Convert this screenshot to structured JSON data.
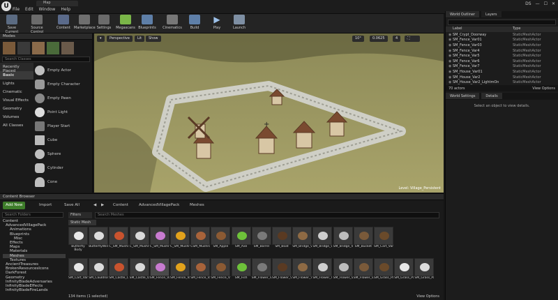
{
  "window": {
    "tab_title": "Map",
    "menu": [
      "File",
      "Edit",
      "Window",
      "Help"
    ],
    "right_label": "DS"
  },
  "toolbar": {
    "buttons": [
      {
        "label": "Save Current",
        "color": "#5b6b82"
      },
      {
        "label": "Source Control",
        "color": "#6b6b6b"
      },
      {
        "label": "Content",
        "color": "#5a6a8a"
      },
      {
        "label": "Marketplace",
        "color": "#6f6f6f"
      },
      {
        "label": "Settings",
        "color": "#6b6b6b"
      },
      {
        "label": "Megascans",
        "color": "#7ab648"
      },
      {
        "label": "Blueprints",
        "color": "#5e7fa8"
      },
      {
        "label": "Cinematics",
        "color": "#777777"
      },
      {
        "label": "Build",
        "color": "#5e7fa8"
      },
      {
        "label": "Play",
        "color": "#6a8fb8"
      },
      {
        "label": "Launch",
        "color": "#7e8fa3"
      }
    ]
  },
  "modes": {
    "title": "Modes",
    "search_placeholder": "Search Classes",
    "categories": [
      "Recently Placed",
      "Basic",
      "Lights",
      "Cinematic",
      "Visual Effects",
      "Geometry",
      "Volumes",
      "All Classes"
    ],
    "selected_category": "Basic",
    "actors": [
      "Empty Actor",
      "Empty Character",
      "Empty Pawn",
      "Point Light",
      "Player Start",
      "Cube",
      "Sphere",
      "Cylinder",
      "Cone"
    ]
  },
  "viewport": {
    "view": "Perspective",
    "lit": "Lit",
    "show": "Show",
    "snap1": "10°",
    "snap2": "0.0625",
    "snap3": "4",
    "level": "Level: Village_Persistent"
  },
  "outliner": {
    "tabs": [
      "World Outliner",
      "Layers"
    ],
    "col_label": "Label",
    "col_type": "Type",
    "rows": [
      {
        "label": "SM_Crypt_Doorway",
        "type": "StaticMeshActor"
      },
      {
        "label": "SM_Fence_Var01",
        "type": "StaticMeshActor"
      },
      {
        "label": "SM_Fence_Var03",
        "type": "StaticMeshActor"
      },
      {
        "label": "SM_Fence_Var4",
        "type": "StaticMeshActor"
      },
      {
        "label": "SM_Fence_Var5",
        "type": "StaticMeshActor"
      },
      {
        "label": "SM_Fence_Var6",
        "type": "StaticMeshActor"
      },
      {
        "label": "SM_Fence_Var7",
        "type": "StaticMeshActor"
      },
      {
        "label": "SM_House_Var01",
        "type": "StaticMeshActor"
      },
      {
        "label": "SM_House_Var2",
        "type": "StaticMeshActor"
      },
      {
        "label": "SM_House_Var2_LightmOn",
        "type": "StaticMeshActor"
      }
    ],
    "count": "70 actors",
    "view_options": "View Options"
  },
  "details": {
    "tabs": [
      "World Settings",
      "Details"
    ],
    "message": "Select an object to view details."
  },
  "content": {
    "title": "Content Browser",
    "add_new": "Add New",
    "import": "Import",
    "save_all": "Save All",
    "path": [
      "Content",
      "AdvancedVillagePack",
      "Meshes"
    ],
    "filters": "Filters",
    "search_placeholder": "Search Meshes",
    "search_folders": "Search Folders",
    "filter_tag": "Static Mesh",
    "tree": [
      "Content",
      "AdvancedVillagePack",
      "Animations",
      "Blueprints",
      "Misc",
      "Effects",
      "Maps",
      "Materials",
      "Meshes",
      "Textures",
      "AncientTreasures",
      "BrokenResourcesIcons",
      "DarkForest",
      "Geometry",
      "InfinityBladeAdversaries",
      "InfinityBladeEffects",
      "InfinityBladeFireLands"
    ],
    "row1": [
      "Butterfly Body",
      "ButterflyWing",
      "C_SM_Mushroom_Var06",
      "C_SM_Mushroom_Var07",
      "C_SM_Mushroom_Var01",
      "C_SM_Mushroom_Var08",
      "CSM_Mushroom_Var07",
      "SM_Apple",
      "SM_Axe",
      "SM_Barrel",
      "SM_Boat",
      "SM_Bridge_Var01",
      "SM_Bridge_Var02",
      "SM_Bridge_Var04",
      "SM_Bucket",
      "SM_Cart_Var01"
    ],
    "row2": [
      "SM_Cart_Var02",
      "SM_Cauldron",
      "SM_Castle_Closed",
      "SM_Castle_Open",
      "SM_Fence_Var01",
      "SM_Fence_Var02",
      "SM_Fence_Var03",
      "SM_Fence_Var04",
      "SM_Fish",
      "SM_Flower_Var01",
      "SM_Flower_Var02",
      "SM_Flower_Var03",
      "SM_Flower_Var04",
      "SM_Flower_Var05",
      "SM_Flower_Var06",
      "SM_Grass_Patch_Var01",
      "SM_Grass_Patch_Var01_FoliageType",
      "SM_Grass_Patch_Var01_FoliageType"
    ],
    "status": "134 items (1 selected)",
    "view_options": "View Options"
  }
}
